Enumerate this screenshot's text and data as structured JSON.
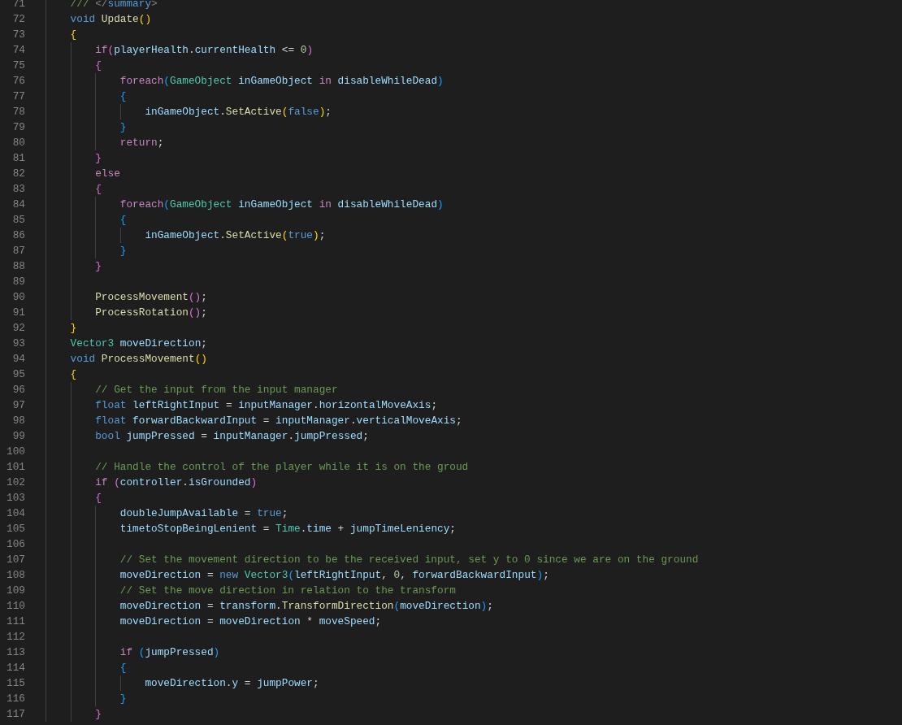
{
  "editor": {
    "lines": [
      {
        "number": "71",
        "tokens": [
          {
            "kind": "comment",
            "text": "/// "
          },
          {
            "kind": "tagmark",
            "text": "</"
          },
          {
            "kind": "tagname",
            "text": "summary"
          },
          {
            "kind": "tagmark",
            "text": ">"
          }
        ]
      },
      {
        "number": "72",
        "tokens": [
          {
            "kind": "keyword",
            "text": "void "
          },
          {
            "kind": "function",
            "text": "Update"
          },
          {
            "kind": "bracketA",
            "text": "()"
          }
        ]
      },
      {
        "number": "73",
        "tokens": [
          {
            "kind": "bracketA",
            "text": "{"
          }
        ],
        "children": [
          {
            "number": "74",
            "tokens": [
              {
                "kind": "control",
                "text": "if"
              },
              {
                "kind": "bracketB",
                "text": "("
              },
              {
                "kind": "variable",
                "text": "playerHealth"
              },
              {
                "kind": "plain",
                "text": "."
              },
              {
                "kind": "variable",
                "text": "currentHealth"
              },
              {
                "kind": "plain",
                "text": " <= "
              },
              {
                "kind": "number",
                "text": "0"
              },
              {
                "kind": "bracketB",
                "text": ")"
              }
            ]
          },
          {
            "number": "75",
            "tokens": [
              {
                "kind": "bracketB",
                "text": "{"
              }
            ],
            "children": [
              {
                "number": "76",
                "tokens": [
                  {
                    "kind": "control",
                    "text": "foreach"
                  },
                  {
                    "kind": "bracketC",
                    "text": "("
                  },
                  {
                    "kind": "type",
                    "text": "GameObject "
                  },
                  {
                    "kind": "variable",
                    "text": "inGameObject "
                  },
                  {
                    "kind": "control",
                    "text": "in "
                  },
                  {
                    "kind": "variable",
                    "text": "disableWhileDead"
                  },
                  {
                    "kind": "bracketC",
                    "text": ")"
                  }
                ]
              },
              {
                "number": "77",
                "tokens": [
                  {
                    "kind": "bracketC",
                    "text": "{"
                  }
                ],
                "children": [
                  {
                    "number": "78",
                    "tokens": [
                      {
                        "kind": "variable",
                        "text": "inGameObject"
                      },
                      {
                        "kind": "plain",
                        "text": "."
                      },
                      {
                        "kind": "function",
                        "text": "SetActive"
                      },
                      {
                        "kind": "bracketA",
                        "text": "("
                      },
                      {
                        "kind": "keyword",
                        "text": "false"
                      },
                      {
                        "kind": "bracketA",
                        "text": ")"
                      },
                      {
                        "kind": "plain",
                        "text": ";"
                      }
                    ]
                  }
                ]
              },
              {
                "number": "79",
                "tokens": [
                  {
                    "kind": "bracketC",
                    "text": "}"
                  }
                ]
              },
              {
                "number": "80",
                "tokens": [
                  {
                    "kind": "control",
                    "text": "return"
                  },
                  {
                    "kind": "plain",
                    "text": ";"
                  }
                ]
              }
            ]
          },
          {
            "number": "81",
            "tokens": [
              {
                "kind": "bracketB",
                "text": "}"
              }
            ]
          },
          {
            "number": "82",
            "tokens": [
              {
                "kind": "control",
                "text": "else"
              }
            ]
          },
          {
            "number": "83",
            "tokens": [
              {
                "kind": "bracketB",
                "text": "{"
              }
            ],
            "children": [
              {
                "number": "84",
                "tokens": [
                  {
                    "kind": "control",
                    "text": "foreach"
                  },
                  {
                    "kind": "bracketC",
                    "text": "("
                  },
                  {
                    "kind": "type",
                    "text": "GameObject "
                  },
                  {
                    "kind": "variable",
                    "text": "inGameObject "
                  },
                  {
                    "kind": "control",
                    "text": "in "
                  },
                  {
                    "kind": "variable",
                    "text": "disableWhileDead"
                  },
                  {
                    "kind": "bracketC",
                    "text": ")"
                  }
                ]
              },
              {
                "number": "85",
                "tokens": [
                  {
                    "kind": "bracketC",
                    "text": "{"
                  }
                ],
                "children": [
                  {
                    "number": "86",
                    "tokens": [
                      {
                        "kind": "variable",
                        "text": "inGameObject"
                      },
                      {
                        "kind": "plain",
                        "text": "."
                      },
                      {
                        "kind": "function",
                        "text": "SetActive"
                      },
                      {
                        "kind": "bracketA",
                        "text": "("
                      },
                      {
                        "kind": "keyword",
                        "text": "true"
                      },
                      {
                        "kind": "bracketA",
                        "text": ")"
                      },
                      {
                        "kind": "plain",
                        "text": ";"
                      }
                    ]
                  }
                ]
              },
              {
                "number": "87",
                "tokens": [
                  {
                    "kind": "bracketC",
                    "text": "}"
                  }
                ]
              }
            ]
          },
          {
            "number": "88",
            "tokens": [
              {
                "kind": "bracketB",
                "text": "}"
              }
            ]
          },
          {
            "number": "89"
          },
          {
            "number": "90",
            "tokens": [
              {
                "kind": "function",
                "text": "ProcessMovement"
              },
              {
                "kind": "bracketB",
                "text": "()"
              },
              {
                "kind": "plain",
                "text": ";"
              }
            ]
          },
          {
            "number": "91",
            "tokens": [
              {
                "kind": "function",
                "text": "ProcessRotation"
              },
              {
                "kind": "bracketB",
                "text": "()"
              },
              {
                "kind": "plain",
                "text": ";"
              }
            ]
          }
        ]
      },
      {
        "number": "92",
        "tokens": [
          {
            "kind": "bracketA",
            "text": "}"
          }
        ]
      },
      {
        "number": "93",
        "tokens": [
          {
            "kind": "type",
            "text": "Vector3 "
          },
          {
            "kind": "variable",
            "text": "moveDirection"
          },
          {
            "kind": "plain",
            "text": ";"
          }
        ]
      },
      {
        "number": "94",
        "tokens": [
          {
            "kind": "keyword",
            "text": "void "
          },
          {
            "kind": "function",
            "text": "ProcessMovement"
          },
          {
            "kind": "bracketA",
            "text": "()"
          }
        ]
      },
      {
        "number": "95",
        "tokens": [
          {
            "kind": "bracketA",
            "text": "{"
          }
        ],
        "children": [
          {
            "number": "96",
            "tokens": [
              {
                "kind": "comment",
                "text": "// Get the input from the input manager"
              }
            ]
          },
          {
            "number": "97",
            "tokens": [
              {
                "kind": "keyword",
                "text": "float "
              },
              {
                "kind": "variable",
                "text": "leftRightInput"
              },
              {
                "kind": "plain",
                "text": " = "
              },
              {
                "kind": "variable",
                "text": "inputManager"
              },
              {
                "kind": "plain",
                "text": "."
              },
              {
                "kind": "variable",
                "text": "horizontalMoveAxis"
              },
              {
                "kind": "plain",
                "text": ";"
              }
            ]
          },
          {
            "number": "98",
            "tokens": [
              {
                "kind": "keyword",
                "text": "float "
              },
              {
                "kind": "variable",
                "text": "forwardBackwardInput"
              },
              {
                "kind": "plain",
                "text": " = "
              },
              {
                "kind": "variable",
                "text": "inputManager"
              },
              {
                "kind": "plain",
                "text": "."
              },
              {
                "kind": "variable",
                "text": "verticalMoveAxis"
              },
              {
                "kind": "plain",
                "text": ";"
              }
            ]
          },
          {
            "number": "99",
            "tokens": [
              {
                "kind": "keyword",
                "text": "bool "
              },
              {
                "kind": "variable",
                "text": "jumpPressed"
              },
              {
                "kind": "plain",
                "text": " = "
              },
              {
                "kind": "variable",
                "text": "inputManager"
              },
              {
                "kind": "plain",
                "text": "."
              },
              {
                "kind": "variable",
                "text": "jumpPressed"
              },
              {
                "kind": "plain",
                "text": ";"
              }
            ]
          },
          {
            "number": "100"
          },
          {
            "number": "101",
            "tokens": [
              {
                "kind": "comment",
                "text": "// Handle the control of the player while it is on the groud"
              }
            ]
          },
          {
            "number": "102",
            "tokens": [
              {
                "kind": "control",
                "text": "if "
              },
              {
                "kind": "bracketB",
                "text": "("
              },
              {
                "kind": "variable",
                "text": "controller"
              },
              {
                "kind": "plain",
                "text": "."
              },
              {
                "kind": "variable",
                "text": "isGrounded"
              },
              {
                "kind": "bracketB",
                "text": ")"
              }
            ]
          },
          {
            "number": "103",
            "tokens": [
              {
                "kind": "bracketB",
                "text": "{"
              }
            ],
            "children": [
              {
                "number": "104",
                "tokens": [
                  {
                    "kind": "variable",
                    "text": "doubleJumpAvailable"
                  },
                  {
                    "kind": "plain",
                    "text": " = "
                  },
                  {
                    "kind": "keyword",
                    "text": "true"
                  },
                  {
                    "kind": "plain",
                    "text": ";"
                  }
                ]
              },
              {
                "number": "105",
                "tokens": [
                  {
                    "kind": "variable",
                    "text": "timetoStopBeingLenient"
                  },
                  {
                    "kind": "plain",
                    "text": " = "
                  },
                  {
                    "kind": "type",
                    "text": "Time"
                  },
                  {
                    "kind": "plain",
                    "text": "."
                  },
                  {
                    "kind": "variable",
                    "text": "time"
                  },
                  {
                    "kind": "plain",
                    "text": " + "
                  },
                  {
                    "kind": "variable",
                    "text": "jumpTimeLeniency"
                  },
                  {
                    "kind": "plain",
                    "text": ";"
                  }
                ]
              },
              {
                "number": "106"
              },
              {
                "number": "107",
                "tokens": [
                  {
                    "kind": "comment",
                    "text": "// Set the movement direction to be the received input, set y to 0 since we are on the ground"
                  }
                ]
              },
              {
                "number": "108",
                "tokens": [
                  {
                    "kind": "variable",
                    "text": "moveDirection"
                  },
                  {
                    "kind": "plain",
                    "text": " = "
                  },
                  {
                    "kind": "keyword",
                    "text": "new "
                  },
                  {
                    "kind": "type",
                    "text": "Vector3"
                  },
                  {
                    "kind": "bracketC",
                    "text": "("
                  },
                  {
                    "kind": "variable",
                    "text": "leftRightInput"
                  },
                  {
                    "kind": "plain",
                    "text": ", "
                  },
                  {
                    "kind": "number",
                    "text": "0"
                  },
                  {
                    "kind": "plain",
                    "text": ", "
                  },
                  {
                    "kind": "variable",
                    "text": "forwardBackwardInput"
                  },
                  {
                    "kind": "bracketC",
                    "text": ")"
                  },
                  {
                    "kind": "plain",
                    "text": ";"
                  }
                ]
              },
              {
                "number": "109",
                "tokens": [
                  {
                    "kind": "comment",
                    "text": "// Set the move direction in relation to the transform"
                  }
                ]
              },
              {
                "number": "110",
                "tokens": [
                  {
                    "kind": "variable",
                    "text": "moveDirection"
                  },
                  {
                    "kind": "plain",
                    "text": " = "
                  },
                  {
                    "kind": "variable",
                    "text": "transform"
                  },
                  {
                    "kind": "plain",
                    "text": "."
                  },
                  {
                    "kind": "function",
                    "text": "TransformDirection"
                  },
                  {
                    "kind": "bracketC",
                    "text": "("
                  },
                  {
                    "kind": "variable",
                    "text": "moveDirection"
                  },
                  {
                    "kind": "bracketC",
                    "text": ")"
                  },
                  {
                    "kind": "plain",
                    "text": ";"
                  }
                ]
              },
              {
                "number": "111",
                "tokens": [
                  {
                    "kind": "variable",
                    "text": "moveDirection"
                  },
                  {
                    "kind": "plain",
                    "text": " = "
                  },
                  {
                    "kind": "variable",
                    "text": "moveDirection"
                  },
                  {
                    "kind": "plain",
                    "text": " * "
                  },
                  {
                    "kind": "variable",
                    "text": "moveSpeed"
                  },
                  {
                    "kind": "plain",
                    "text": ";"
                  }
                ]
              },
              {
                "number": "112"
              },
              {
                "number": "113",
                "tokens": [
                  {
                    "kind": "control",
                    "text": "if "
                  },
                  {
                    "kind": "bracketC",
                    "text": "("
                  },
                  {
                    "kind": "variable",
                    "text": "jumpPressed"
                  },
                  {
                    "kind": "bracketC",
                    "text": ")"
                  }
                ]
              },
              {
                "number": "114",
                "tokens": [
                  {
                    "kind": "bracketC",
                    "text": "{"
                  }
                ],
                "children": [
                  {
                    "number": "115",
                    "tokens": [
                      {
                        "kind": "variable",
                        "text": "moveDirection"
                      },
                      {
                        "kind": "plain",
                        "text": "."
                      },
                      {
                        "kind": "variable",
                        "text": "y"
                      },
                      {
                        "kind": "plain",
                        "text": " = "
                      },
                      {
                        "kind": "variable",
                        "text": "jumpPower"
                      },
                      {
                        "kind": "plain",
                        "text": ";"
                      }
                    ]
                  }
                ]
              },
              {
                "number": "116",
                "tokens": [
                  {
                    "kind": "bracketC",
                    "text": "}"
                  }
                ]
              }
            ]
          },
          {
            "number": "117",
            "tokens": [
              {
                "kind": "bracketB",
                "text": "}"
              }
            ]
          }
        ]
      }
    ]
  }
}
